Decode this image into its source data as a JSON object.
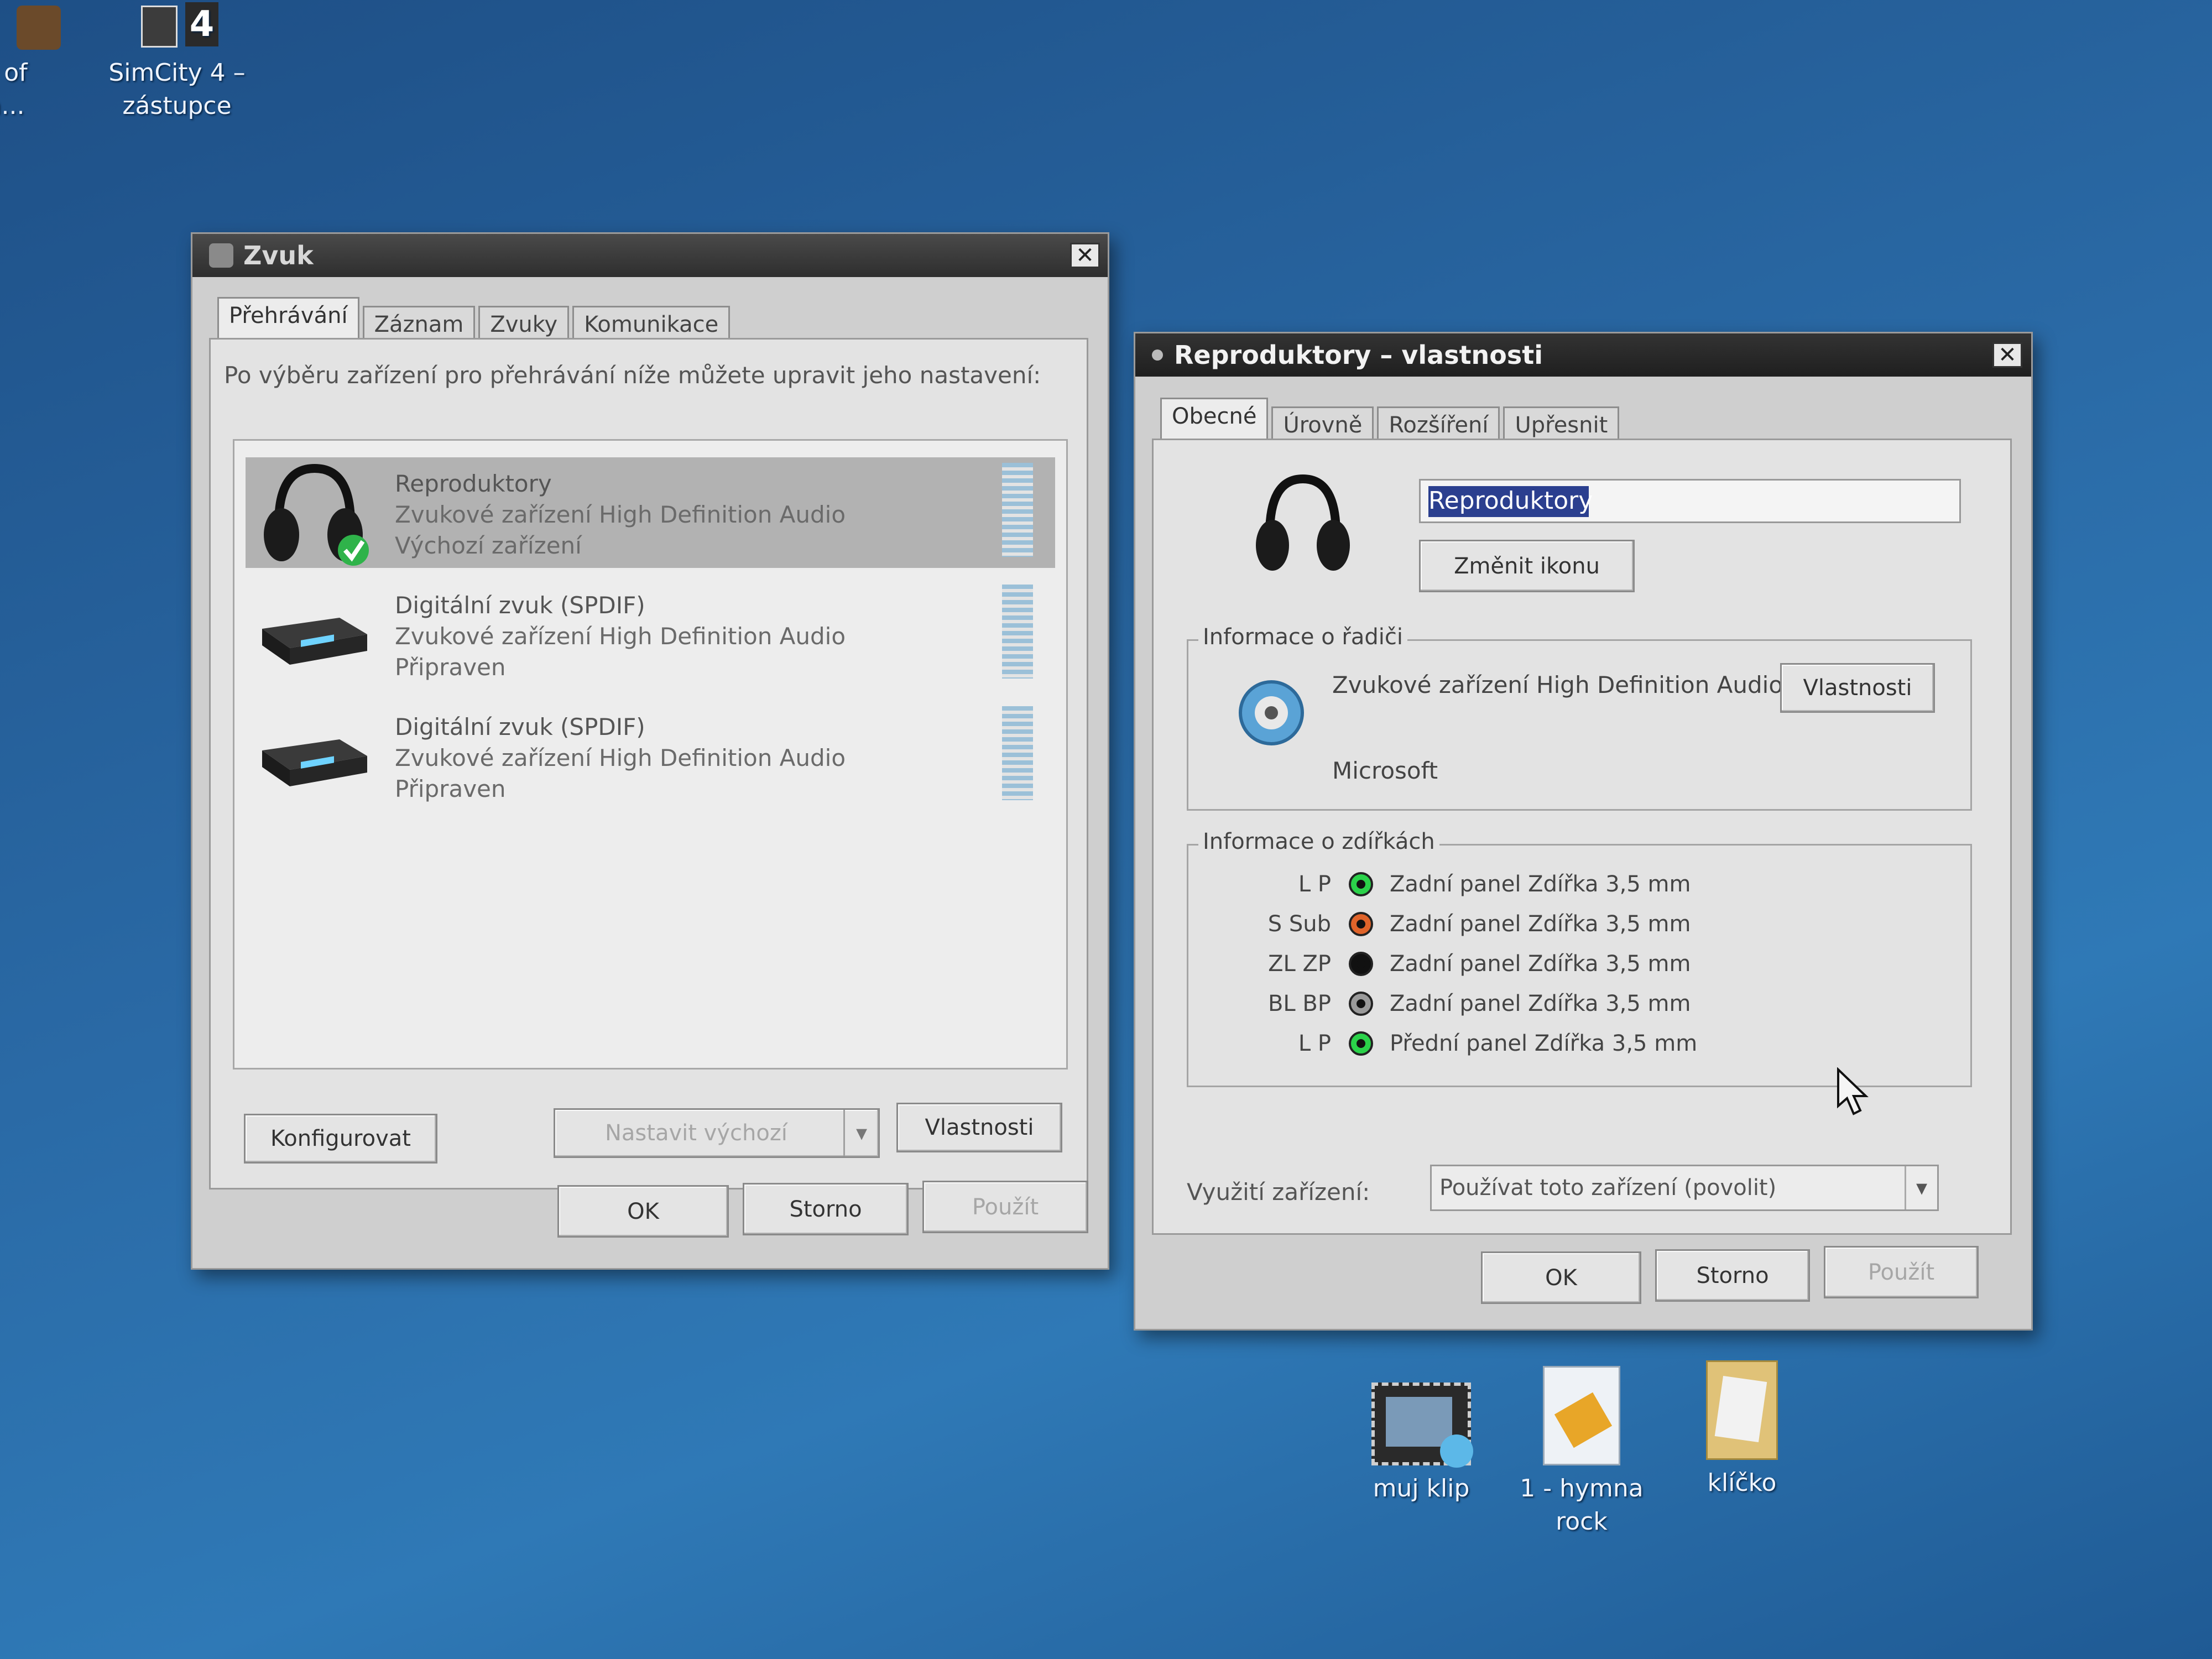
{
  "desktop": {
    "top_icons": [
      {
        "label_line1": "s of",
        "label_line2": "a..."
      },
      {
        "label_line1": "SimCity 4 –",
        "label_line2": "zástupce"
      }
    ],
    "bottom_icons": [
      {
        "label": "muj klip",
        "icon": "video-file-icon"
      },
      {
        "label": "1 - hymna rock",
        "icon": "audio-file-icon"
      },
      {
        "label": "klíčko",
        "icon": "folder-icon"
      }
    ]
  },
  "sound_window": {
    "title": "Zvuk",
    "tabs": [
      "Přehrávání",
      "Záznam",
      "Zvuky",
      "Komunikace"
    ],
    "instruction": "Po výběru zařízení pro přehrávání níže můžete upravit jeho nastavení:",
    "devices": [
      {
        "name": "Reproduktory",
        "type": "Zvukové zařízení High Definition Audio",
        "status": "Výchozí zařízení",
        "icon": "headphones-icon"
      },
      {
        "name": "Digitální zvuk (SPDIF)",
        "type": "Zvukové zařízení High Definition Audio",
        "status": "Připraven",
        "icon": "digital-receiver-icon"
      },
      {
        "name": "Digitální zvuk (SPDIF)",
        "type": "Zvukové zařízení High Definition Audio",
        "status": "Připraven",
        "icon": "digital-receiver-icon"
      }
    ],
    "buttons": {
      "configure": "Konfigurovat",
      "set_default": "Nastavit výchozí",
      "properties": "Vlastnosti",
      "ok": "OK",
      "cancel": "Storno",
      "apply": "Použít"
    }
  },
  "props_window": {
    "title": "Reproduktory – vlastnosti",
    "tabs": [
      "Obecné",
      "Úrovně",
      "Rozšíření",
      "Upřesnit"
    ],
    "device_name_value": "Reproduktory",
    "change_icon": "Změnit ikonu",
    "controller_group": "Informace o řadiči",
    "controller_name": "Zvukové zařízení High Definition Audio",
    "controller_properties": "Vlastnosti",
    "controller_vendor": "Microsoft",
    "jacks_group": "Informace o zdířkách",
    "jacks": [
      {
        "channel": "L P",
        "desc": "Zadní panel Zdířka 3,5 mm",
        "color": "#2bd24a"
      },
      {
        "channel": "S Sub",
        "desc": "Zadní panel Zdířka 3,5 mm",
        "color": "#e0642a"
      },
      {
        "channel": "ZL ZP",
        "desc": "Zadní panel Zdířka 3,5 mm",
        "color": "#111111"
      },
      {
        "channel": "BL BP",
        "desc": "Zadní panel Zdířka 3,5 mm",
        "color": "#9a9a9a"
      },
      {
        "channel": "L P",
        "desc": "Přední panel Zdířka 3,5 mm",
        "color": "#2bd24a"
      }
    ],
    "usage_label": "Využití zařízení:",
    "usage_value": "Používat toto zařízení (povolit)",
    "buttons": {
      "ok": "OK",
      "cancel": "Storno",
      "apply": "Použít"
    }
  }
}
